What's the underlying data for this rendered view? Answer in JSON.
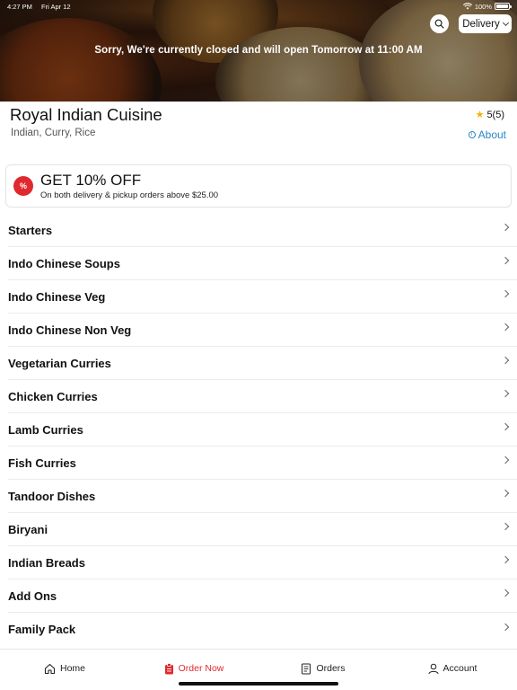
{
  "status_bar": {
    "time": "4:27 PM",
    "date": "Fri Apr 12",
    "battery": "100%"
  },
  "hero": {
    "closed_message": "Sorry, We're currently closed and will open Tomorrow at 11:00 AM",
    "order_mode": "Delivery",
    "search_icon": "search-icon"
  },
  "restaurant": {
    "name": "Royal Indian Cuisine",
    "cuisines": "Indian, Curry, Rice",
    "rating": "5(5)",
    "about_label": "About"
  },
  "offer": {
    "badge": "%",
    "title": "GET 10% OFF",
    "subtitle": "On both delivery & pickup orders above $25.00"
  },
  "menu": {
    "categories": [
      "Starters",
      "Indo Chinese Soups",
      "Indo Chinese Veg",
      "Indo Chinese Non Veg",
      "Vegetarian Curries",
      "Chicken Curries",
      "Lamb Curries",
      "Fish Curries",
      "Tandoor Dishes",
      "Biryani",
      "Indian Breads",
      "Add Ons",
      "Family Pack"
    ]
  },
  "bottom_nav": {
    "items": [
      {
        "label": "Home",
        "icon": "home-icon"
      },
      {
        "label": "Order Now",
        "icon": "order-icon"
      },
      {
        "label": "Orders",
        "icon": "receipt-icon"
      },
      {
        "label": "Account",
        "icon": "person-icon"
      }
    ],
    "active": "Order Now"
  },
  "colors": {
    "accent": "#e0282e",
    "link": "#2b86c5",
    "star": "#f0b400"
  }
}
